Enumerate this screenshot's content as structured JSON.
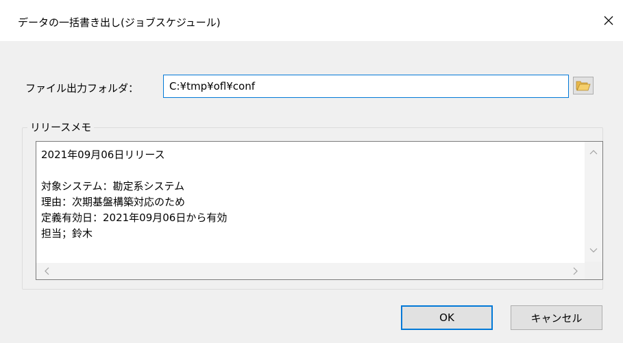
{
  "window": {
    "title": "データの一括書き出し(ジョブスケジュール)",
    "close_icon": "close-icon"
  },
  "folder": {
    "label": "ファイル出力フォルダ：",
    "value": "C:¥tmp¥ofl¥conf",
    "browse_icon": "folder-open-icon"
  },
  "release_memo": {
    "group_label": "リリースメモ",
    "text": "2021年09月06日リリース\n\n対象システム：勘定系システム\n理由：次期基盤構築対応のため\n定義有効日：2021年09月06日から有効\n担当；鈴木"
  },
  "buttons": {
    "ok": "OK",
    "cancel": "キャンセル"
  },
  "colors": {
    "focus_border": "#0078d7",
    "folder_icon": "#e8b84a"
  }
}
